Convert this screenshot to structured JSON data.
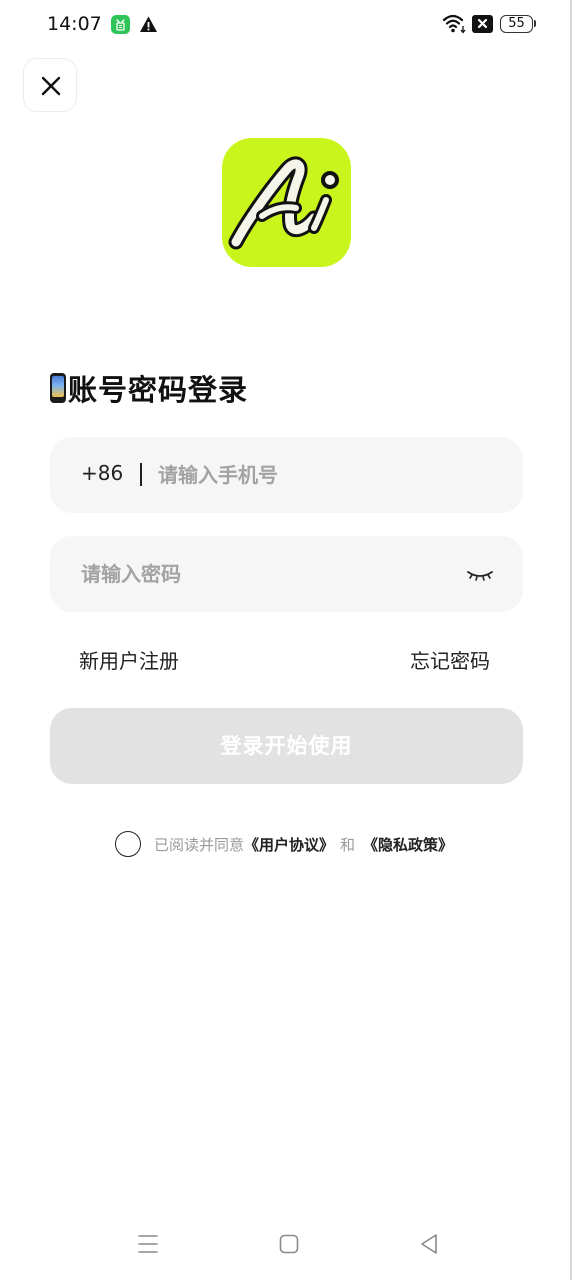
{
  "status_bar": {
    "time": "14:07",
    "battery": "55",
    "icons": [
      "app-notification-icon",
      "warning-icon",
      "wifi-icon",
      "no-sim-icon",
      "battery-icon"
    ]
  },
  "header": {
    "close_icon": "close-icon"
  },
  "logo": {
    "icon": "app-logo-icon",
    "accent_color": "#c9f51c"
  },
  "title": {
    "icon": "mobile-phone-emoji-icon",
    "text": "账号密码登录"
  },
  "phone_field": {
    "country_code": "+86",
    "placeholder": "请输入手机号",
    "value": ""
  },
  "password_field": {
    "placeholder": "请输入密码",
    "value": "",
    "toggle_icon": "eye-closed-icon"
  },
  "links": {
    "register": "新用户注册",
    "forgot": "忘记密码"
  },
  "submit": {
    "label": "登录开始使用",
    "state": "disabled"
  },
  "agreement": {
    "prefix": "已阅读并同意",
    "user_agreement": "《用户协议》",
    "and": "和",
    "privacy_policy": "《隐私政策》",
    "checked": false
  },
  "nav_bar": {
    "icons": [
      "menu-icon",
      "home-icon",
      "back-icon"
    ]
  }
}
